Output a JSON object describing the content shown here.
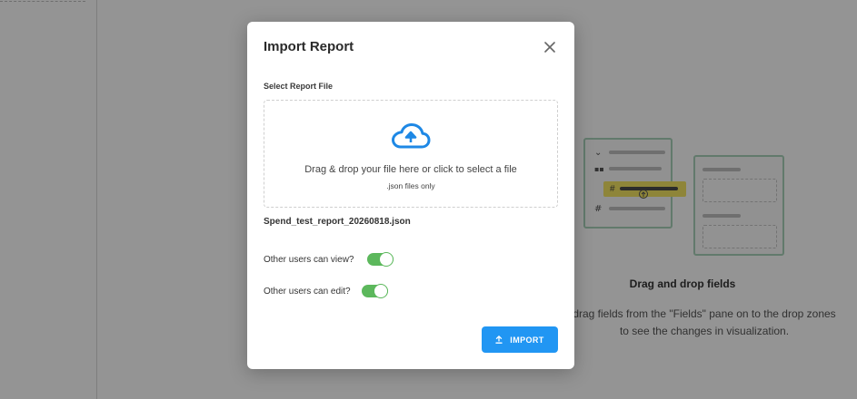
{
  "background": {
    "empty_state": {
      "title": "Drag and drop fields",
      "description_line1": "drag fields from the \"Fields\" pane on to the drop zones",
      "description_line2": "to see the changes in visualization."
    }
  },
  "modal": {
    "title": "Import Report",
    "close_icon": "close-icon",
    "file_field": {
      "label": "Select Report File",
      "dropzone_icon": "cloud-upload-icon",
      "dropzone_text": "Drag & drop your file here or click to select a file",
      "dropzone_hint": ".json files only",
      "selected_file": "Spend_test_report_20260818.json"
    },
    "permissions": [
      {
        "label": "Other users can view?",
        "checked": true
      },
      {
        "label": "Other users can edit?",
        "checked": true
      }
    ],
    "import_button": {
      "label": "IMPORT",
      "icon": "upload-icon"
    }
  },
  "colors": {
    "accent": "#2196f3",
    "toggle_on": "#5cb85c",
    "overlay": "rgba(0,0,0,0.42)"
  }
}
